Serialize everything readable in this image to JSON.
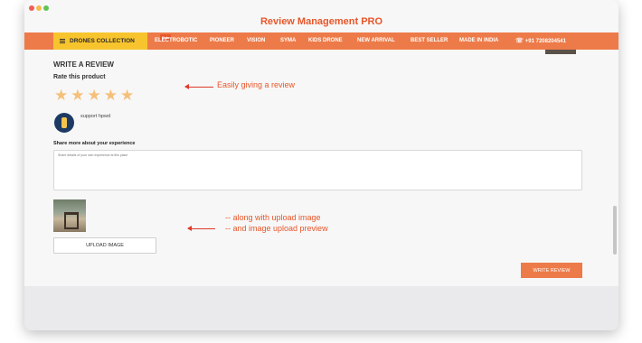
{
  "app": {
    "title": "Review Management PRO"
  },
  "nav": {
    "collection_label": "DRONES COLLECTION",
    "collection_badge": "Sale",
    "items": [
      "ELECTROBOTIC",
      "PIONEER",
      "VISION",
      "SYMA",
      "KIDS DRONE",
      "NEW ARRIVAL",
      "BEST SELLER",
      "MADE IN INDIA"
    ],
    "phone": "+91 7208204541",
    "phone_icon": "phone-icon",
    "accent": "#ed7b49",
    "highlight": "#f7c42e"
  },
  "review": {
    "heading": "WRITE A REVIEW",
    "rate_label": "Rate this product",
    "stars_total": 5,
    "star_color": "#f5c07a",
    "user_name": "support hpwd",
    "share_label": "Share more about your experience",
    "textarea_placeholder": "Share details of your own experience at this place",
    "upload_label": "UPLOAD IMAGE",
    "submit_label": "WRITE REVIEW"
  },
  "annotations": {
    "stars_note": "Easily giving a review",
    "upload_note_1": "-- along with upload image",
    "upload_note_2": "-- and image upload preview"
  }
}
